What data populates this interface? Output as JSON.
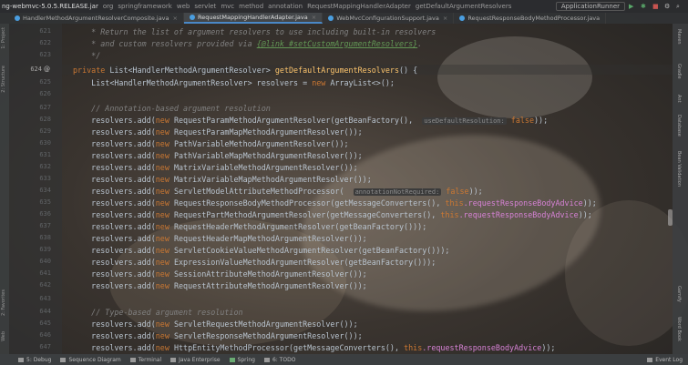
{
  "titlebar": {
    "crumbs": [
      "ng-webmvc-5.0.5.RELEASE.jar",
      "org",
      "springframework",
      "web",
      "servlet",
      "mvc",
      "method",
      "annotation",
      "RequestMappingHandlerAdapter",
      "getDefaultArgumentResolvers"
    ],
    "run_config": "ApplicationRunner"
  },
  "tabs": [
    {
      "label": "HandlerMethodArgumentResolverComposite.java",
      "active": false
    },
    {
      "label": "RequestMappingHandlerAdapter.java",
      "active": true
    },
    {
      "label": "WebMvcConfigurationSupport.java",
      "active": false
    },
    {
      "label": "RequestResponseBodyMethodProcessor.java",
      "active": false
    }
  ],
  "left_tools": [
    "1: Project",
    "2: Structure",
    "2: Favorites",
    "Web"
  ],
  "right_tools": [
    "Maven",
    "Gradle",
    "Ant",
    "Database",
    "Bean Validation",
    "Gamify",
    "Word Book"
  ],
  "gutter": {
    "line_numbers": [
      "621",
      "622",
      "623",
      "624",
      "625",
      "626",
      "627",
      "628",
      "629",
      "630",
      "631",
      "632",
      "633",
      "634",
      "635",
      "636",
      "637",
      "638",
      "639",
      "640",
      "641",
      "642",
      "643",
      "644",
      "645",
      "646",
      "647"
    ],
    "current": "624",
    "mark": "@"
  },
  "code": {
    "l1_comment": "    * Return the list of argument resolvers to use including built-in resolvers",
    "l2_a": "    * and custom resolvers provided via ",
    "l2_link": "{@link #setCustomArgumentResolvers}",
    "l2_b": ".",
    "l3": "    */",
    "l4_kw": "private",
    "l4_rest1": " List<HandlerMethodArgumentResolver> ",
    "l4_method": "getDefaultArgumentResolvers",
    "l4_rest2": "() {",
    "l5_a": "    List<HandlerMethodArgumentResolver> resolvers = ",
    "l5_new": "new",
    "l5_b": " ArrayList<>();",
    "l7_comment": "    // Annotation-based argument resolution",
    "l8_a": "    resolvers.add(",
    "l8_b": " RequestParamMethodArgumentResolver(getBeanFactory(),  ",
    "l8_hint": "useDefaultResolution:",
    "l8_false": " false",
    "l8_end": "));",
    "r_prefix": "    resolvers.add(",
    "kw_new": "new",
    "l9": " RequestParamMapMethodArgumentResolver());",
    "l10": " PathVariableMethodArgumentResolver());",
    "l11": " PathVariableMapMethodArgumentResolver());",
    "l12": " MatrixVariableMethodArgumentResolver());",
    "l13": " MatrixVariableMapMethodArgumentResolver());",
    "l14_a": " ServletModelAttributeMethodProcessor(  ",
    "l14_hint": "annotationNotRequired:",
    "l14_false": " false",
    "l14_end": "));",
    "l15_a": " RequestResponseBodyMethodProcessor(getMessageConverters(), ",
    "kw_this": "this",
    "l15_field": ".requestResponseBodyAdvice",
    "l15_end": "));",
    "l16_a": " RequestPartMethodArgumentResolver(getMessageConverters(), ",
    "l16_field": ".requestResponseBodyAdvice",
    "l16_end": "));",
    "l17": " RequestHeaderMethodArgumentResolver(getBeanFactory()));",
    "l18": " RequestHeaderMapMethodArgumentResolver());",
    "l19": " ServletCookieValueMethodArgumentResolver(getBeanFactory()));",
    "l20": " ExpressionValueMethodArgumentResolver(getBeanFactory()));",
    "l21": " SessionAttributeMethodArgumentResolver());",
    "l22": " RequestAttributeMethodArgumentResolver());",
    "l24_comment": "    // Type-based argument resolution",
    "l25": " ServletRequestMethodArgumentResolver());",
    "l26": " ServletResponseMethodArgumentResolver());",
    "l27_a": " HttpEntityMethodProcessor(getMessageConverters(), ",
    "l27_field": ".requestResponseBodyAdvice",
    "l27_end": "));"
  },
  "bottom": {
    "items": [
      "5: Debug",
      "Sequence Diagram",
      "Terminal",
      "Java Enterprise",
      "Spring",
      "6: TODO"
    ],
    "event_log": "Event Log"
  },
  "colors": {
    "keyword": "#cc7832",
    "comment": "#808080",
    "field": "#d782d6",
    "method": "#ffc66d",
    "tab_accent": "#4a88c7"
  }
}
